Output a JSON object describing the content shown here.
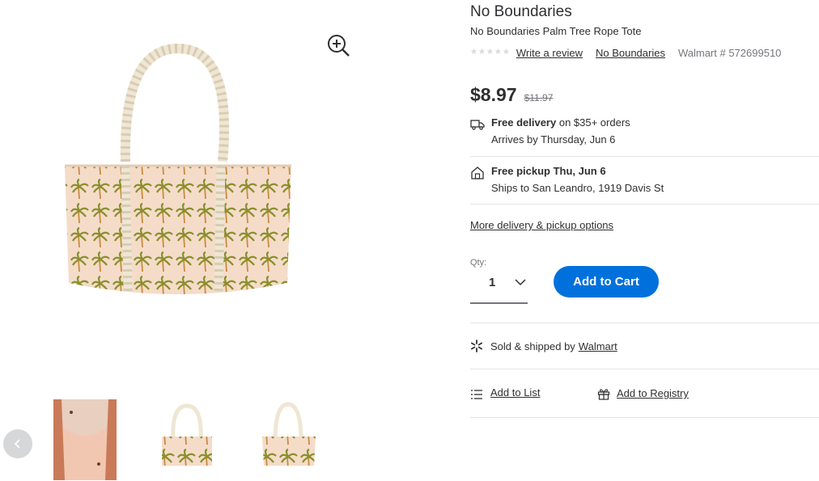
{
  "product": {
    "brand": "No Boundaries",
    "title": "No Boundaries Palm Tree Rope Tote",
    "rating_stars": 5,
    "write_review": "Write a review",
    "brand_link": "No Boundaries",
    "item_number": "Walmart # 572699510",
    "price": "$8.97",
    "was_price": "$11.97"
  },
  "delivery": {
    "title": "Free delivery",
    "condition": "on $35+ orders",
    "eta": "Arrives by Thursday, Jun 6"
  },
  "pickup": {
    "title": "Free pickup Thu, Jun 6",
    "location": "Ships to San Leandro, 1919 Davis St"
  },
  "more_options": "More delivery & pickup options",
  "quantity": {
    "label": "Qty:",
    "value": "1"
  },
  "add_to_cart": "Add to Cart",
  "seller": {
    "prefix": "Sold & shipped by",
    "name": "Walmart"
  },
  "actions": {
    "add_to_list": "Add to List",
    "add_to_registry": "Add to Registry"
  },
  "media": {
    "thumbnail_count": 3,
    "zoom_icon": "zoom-in-icon",
    "prev_icon": "chevron-left-icon"
  },
  "colors": {
    "accent": "#0071dc",
    "text": "#2e2f32",
    "muted": "#74767c",
    "divider": "#e3e4e5",
    "tote": "#f4dcc9",
    "palm_leaf": "#8a8f2c",
    "palm_trunk": "#c98b3e",
    "rope": "#efe6d3"
  }
}
